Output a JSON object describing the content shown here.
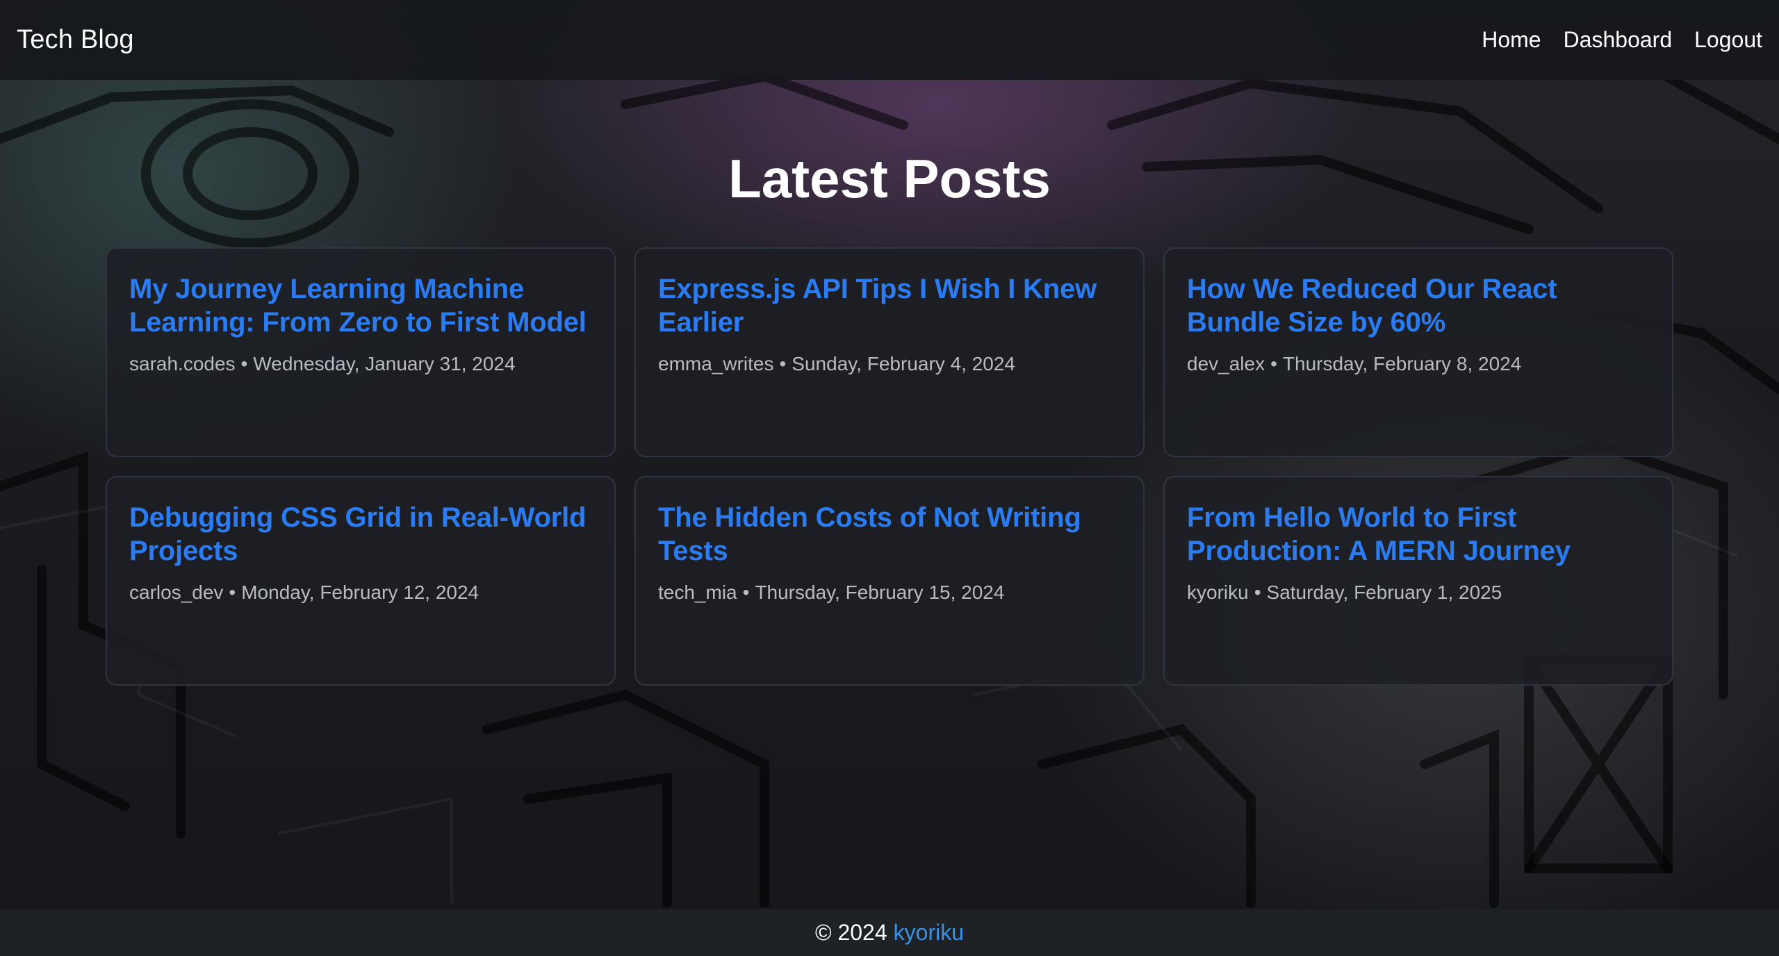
{
  "header": {
    "brand": "Tech Blog",
    "nav": [
      "Home",
      "Dashboard",
      "Logout"
    ]
  },
  "main": {
    "title": "Latest Posts",
    "posts": [
      {
        "title": "My Journey Learning Machine Learning: From Zero to First Model",
        "author": "sarah.codes",
        "date": "Wednesday, January 31, 2024"
      },
      {
        "title": "Express.js API Tips I Wish I Knew Earlier",
        "author": "emma_writes",
        "date": "Sunday, February 4, 2024"
      },
      {
        "title": "How We Reduced Our React Bundle Size by 60%",
        "author": "dev_alex",
        "date": "Thursday, February 8, 2024"
      },
      {
        "title": "Debugging CSS Grid in Real-World Projects",
        "author": "carlos_dev",
        "date": "Monday, February 12, 2024"
      },
      {
        "title": "The Hidden Costs of Not Writing Tests",
        "author": "tech_mia",
        "date": "Thursday, February 15, 2024"
      },
      {
        "title": "From Hello World to First Production: A MERN Journey",
        "author": "kyoriku",
        "date": "Saturday, February 1, 2025"
      }
    ],
    "meta_separator": "•"
  },
  "footer": {
    "copyright": "© 2024",
    "link_text": "kyoriku"
  },
  "colors": {
    "link": "#2b7cf2",
    "footer_link": "#3a93e6",
    "meta": "#b8bcc2"
  }
}
